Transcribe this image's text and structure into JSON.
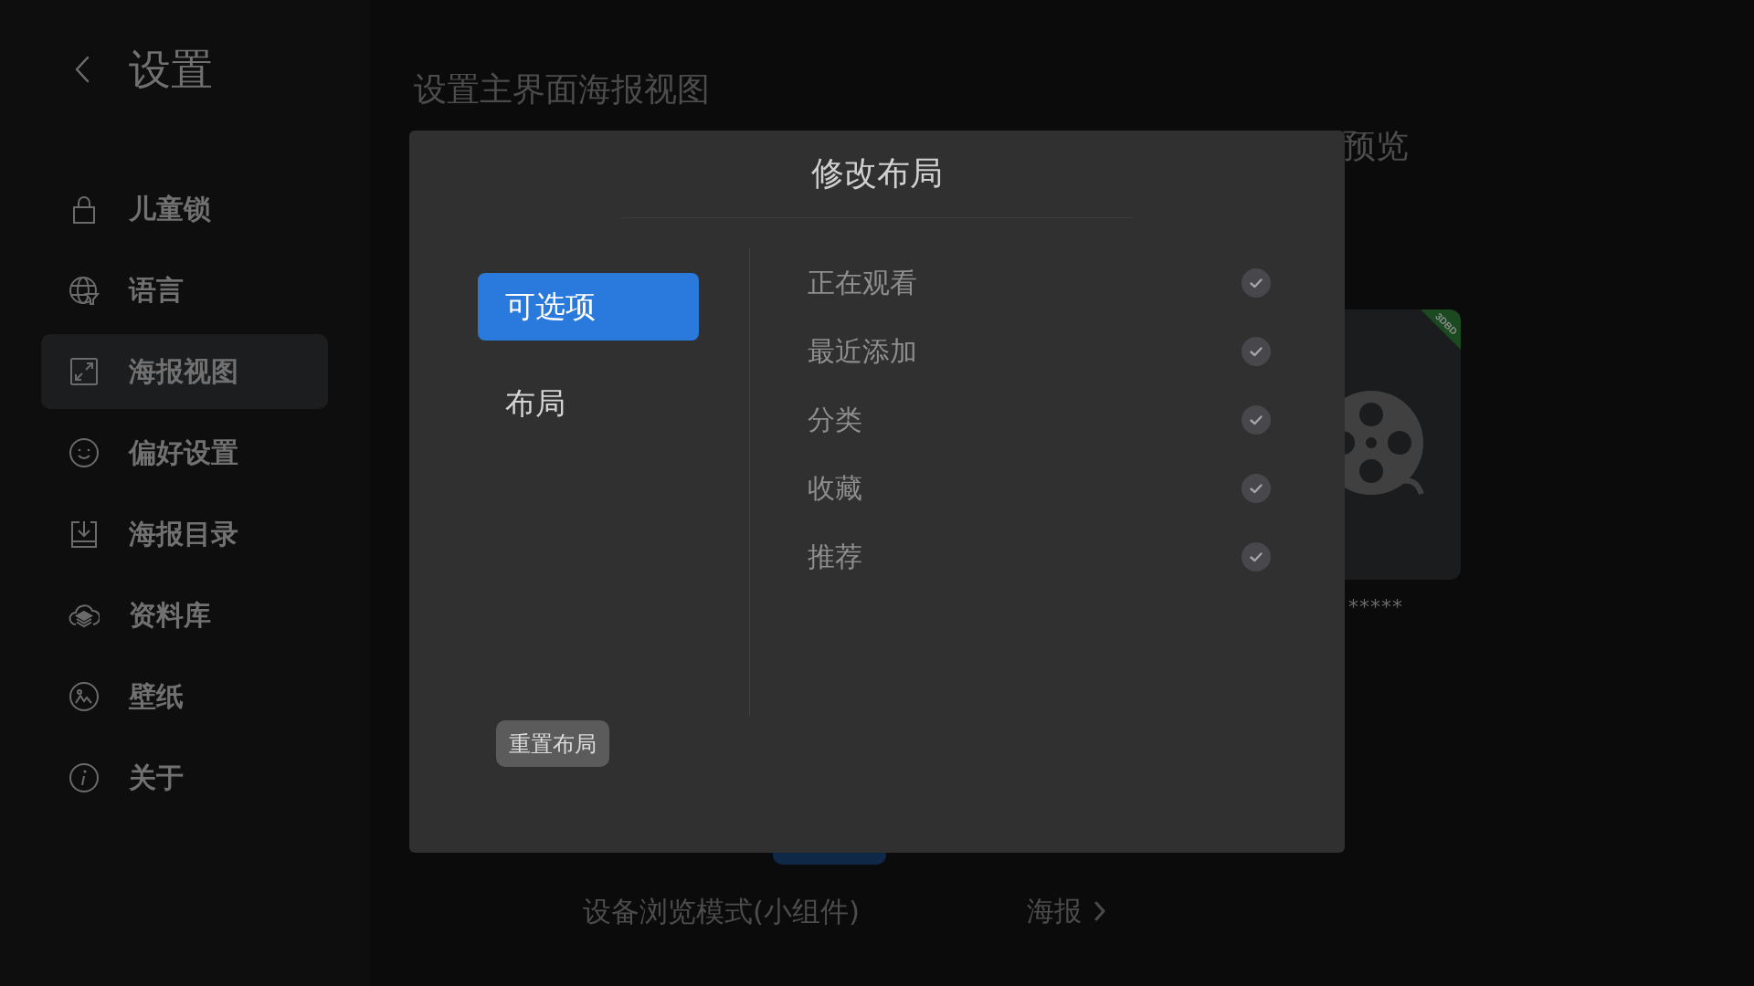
{
  "sidebar": {
    "title": "设置",
    "items": [
      {
        "label": "儿童锁",
        "selected": false
      },
      {
        "label": "语言",
        "selected": false
      },
      {
        "label": "海报视图",
        "selected": true
      },
      {
        "label": "偏好设置",
        "selected": false
      },
      {
        "label": "海报目录",
        "selected": false
      },
      {
        "label": "资料库",
        "selected": false
      },
      {
        "label": "壁纸",
        "selected": false
      },
      {
        "label": "关于",
        "selected": false
      }
    ]
  },
  "main": {
    "title": "设置主界面海报视图",
    "preview": {
      "title": "预览",
      "badge": "3DBD",
      "rating": "*****"
    },
    "mode": {
      "label": "设备浏览模式(小组件)",
      "value": "海报"
    }
  },
  "dialog": {
    "title": "修改布局",
    "tabs": [
      {
        "label": "可选项",
        "selected": true
      },
      {
        "label": "布局",
        "selected": false
      }
    ],
    "options": [
      {
        "label": "正在观看",
        "checked": true
      },
      {
        "label": "最近添加",
        "checked": true
      },
      {
        "label": "分类",
        "checked": true
      },
      {
        "label": "收藏",
        "checked": true
      },
      {
        "label": "推荐",
        "checked": true
      }
    ],
    "reset_button": "重置布局"
  }
}
